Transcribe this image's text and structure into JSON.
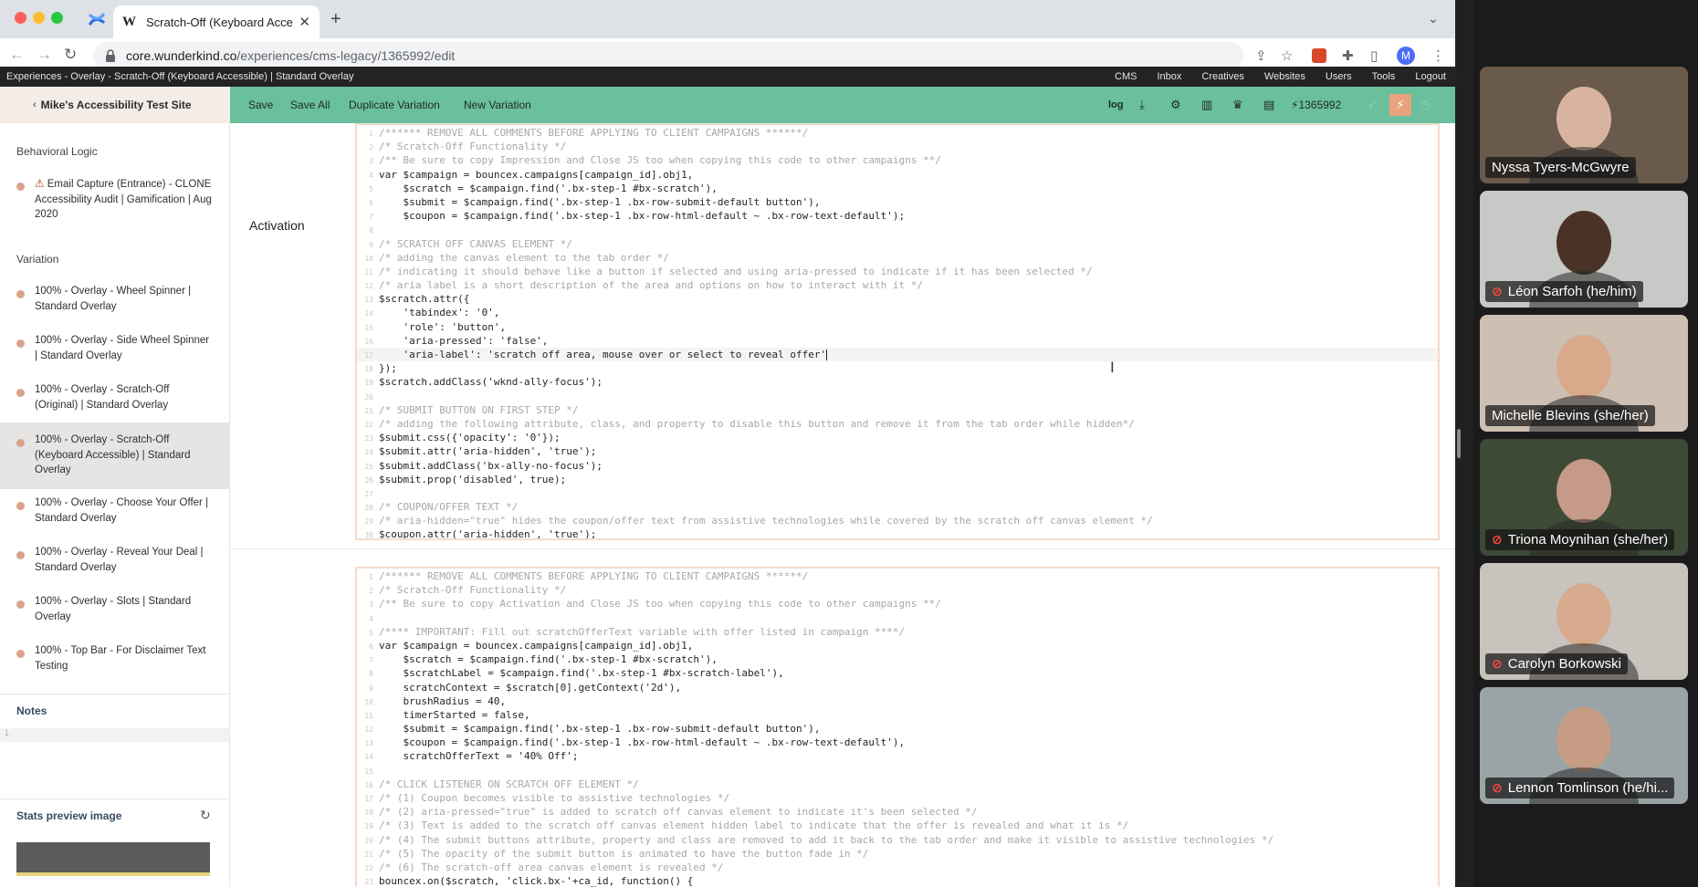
{
  "browser": {
    "tab_title": "Scratch-Off (Keyboard Access",
    "url_host": "core.wunderkind.co",
    "url_path": "/experiences/cms-legacy/1365992/edit",
    "profile_initial": "M"
  },
  "app": {
    "breadcrumb": "Experiences - Overlay - Scratch-Off (Keyboard Accessible) | Standard Overlay",
    "nav": [
      "CMS",
      "Inbox",
      "Creatives",
      "Websites",
      "Users",
      "Tools",
      "Logout"
    ],
    "site_name": "Mike's Accessibility Test Site",
    "actions": {
      "save": "Save",
      "save_all": "Save All",
      "duplicate": "Duplicate Variation",
      "new_variation": "New Variation",
      "log": "log",
      "campaign_id": "1365992"
    }
  },
  "sidebar": {
    "behavioral_heading": "Behavioral Logic",
    "behavioral_item": "Email Capture (Entrance) - CLONE Accessibility Audit | Gamification | Aug 2020",
    "variation_heading": "Variation",
    "variations": [
      "100% - Overlay - Wheel Spinner | Standard Overlay",
      "100% - Overlay - Side Wheel Spinner | Standard Overlay",
      "100% - Overlay - Scratch-Off (Original) | Standard Overlay",
      "100% - Overlay - Scratch-Off (Keyboard Accessible) | Standard Overlay",
      "100% - Overlay - Choose Your Offer | Standard Overlay",
      "100% - Overlay - Reveal Your Deal | Standard Overlay",
      "100% - Overlay - Slots | Standard Overlay",
      "100% - Top Bar - For Disclaimer Text Testing"
    ],
    "active_variation_index": 3,
    "notes_label": "Notes",
    "notes_value": "1",
    "stats_label": "Stats preview image"
  },
  "main": {
    "activation_label": "Activation",
    "editor1": [
      {
        "n": "1",
        "t": "/****** REMOVE ALL COMMENTS BEFORE APPLYING TO CLIENT CAMPAIGNS ******/",
        "c": true
      },
      {
        "n": "2",
        "t": "/* Scratch-Off Functionality */",
        "c": true
      },
      {
        "n": "3",
        "t": "/** Be sure to copy Impression and Close JS too when copying this code to other campaigns **/",
        "c": true
      },
      {
        "n": "4",
        "t": "var $campaign = bouncex.campaigns[campaign_id].obj1,"
      },
      {
        "n": "5",
        "t": "    $scratch = $campaign.find('.bx-step-1 #bx-scratch'),"
      },
      {
        "n": "6",
        "t": "    $submit = $campaign.find('.bx-step-1 .bx-row-submit-default button'),"
      },
      {
        "n": "7",
        "t": "    $coupon = $campaign.find('.bx-step-1 .bx-row-html-default ~ .bx-row-text-default');"
      },
      {
        "n": "8",
        "t": ""
      },
      {
        "n": "9",
        "t": "/* SCRATCH OFF CANVAS ELEMENT */",
        "c": true
      },
      {
        "n": "10",
        "t": "/* adding the canvas element to the tab order */",
        "c": true
      },
      {
        "n": "11",
        "t": "/* indicating it should behave like a button if selected and using aria-pressed to indicate if it has been selected */",
        "c": true
      },
      {
        "n": "12",
        "t": "/* aria label is a short description of the area and options on how to interact with it */",
        "c": true
      },
      {
        "n": "13",
        "t": "$scratch.attr({"
      },
      {
        "n": "14",
        "t": "    'tabindex': '0',"
      },
      {
        "n": "15",
        "t": "    'role': 'button',"
      },
      {
        "n": "16",
        "t": "    'aria-pressed': 'false',"
      },
      {
        "n": "17",
        "t": "    'aria-label': 'scratch off area, mouse over or select to reveal offer'",
        "cur": true
      },
      {
        "n": "18",
        "t": "});"
      },
      {
        "n": "19",
        "t": "$scratch.addClass('wknd-ally-focus');"
      },
      {
        "n": "20",
        "t": ""
      },
      {
        "n": "21",
        "t": "/* SUBMIT BUTTON ON FIRST STEP */",
        "c": true
      },
      {
        "n": "22",
        "t": "/* adding the following attribute, class, and property to disable this button and remove it from the tab order while hidden*/",
        "c": true
      },
      {
        "n": "23",
        "t": "$submit.css({'opacity': '0'});"
      },
      {
        "n": "24",
        "t": "$submit.attr('aria-hidden', 'true');"
      },
      {
        "n": "25",
        "t": "$submit.addClass('bx-ally-no-focus');"
      },
      {
        "n": "26",
        "t": "$submit.prop('disabled', true);"
      },
      {
        "n": "27",
        "t": ""
      },
      {
        "n": "28",
        "t": "/* COUPON/OFFER TEXT */",
        "c": true
      },
      {
        "n": "29",
        "t": "/* aria-hidden=\"true\" hides the coupon/offer text from assistive technologies while covered by the scratch off canvas element */",
        "c": true
      },
      {
        "n": "30",
        "t": "$coupon.attr('aria-hidden', 'true');"
      }
    ],
    "editor2": [
      {
        "n": "1",
        "t": "/****** REMOVE ALL COMMENTS BEFORE APPLYING TO CLIENT CAMPAIGNS ******/",
        "c": true
      },
      {
        "n": "2",
        "t": "/* Scratch-Off Functionality */",
        "c": true
      },
      {
        "n": "3",
        "t": "/** Be sure to copy Activation and Close JS too when copying this code to other campaigns **/",
        "c": true
      },
      {
        "n": "4",
        "t": ""
      },
      {
        "n": "5",
        "t": "/**** IMPORTANT: Fill out scratchOfferText variable with offer listed in campaign ****/",
        "c": true
      },
      {
        "n": "6",
        "t": "var $campaign = bouncex.campaigns[campaign_id].obj1,"
      },
      {
        "n": "7",
        "t": "    $scratch = $campaign.find('.bx-step-1 #bx-scratch'),"
      },
      {
        "n": "8",
        "t": "    $scratchLabel = $campaign.find('.bx-step-1 #bx-scratch-label'),"
      },
      {
        "n": "9",
        "t": "    scratchContext = $scratch[0].getContext('2d'),"
      },
      {
        "n": "10",
        "t": "    brushRadius = 40,"
      },
      {
        "n": "11",
        "t": "    timerStarted = false,"
      },
      {
        "n": "12",
        "t": "    $submit = $campaign.find('.bx-step-1 .bx-row-submit-default button'),"
      },
      {
        "n": "13",
        "t": "    $coupon = $campaign.find('.bx-step-1 .bx-row-html-default ~ .bx-row-text-default'),"
      },
      {
        "n": "14",
        "t": "    scratchOfferText = '40% Off';"
      },
      {
        "n": "15",
        "t": ""
      },
      {
        "n": "16",
        "t": "/* CLICK LISTENER ON SCRATCH OFF ELEMENT */",
        "c": true
      },
      {
        "n": "17",
        "t": "/* (1) Coupon becomes visible to assistive technologies */",
        "c": true
      },
      {
        "n": "18",
        "t": "/* (2) aria-pressed=\"true\" is added to scratch off canvas element to indicate it's been selected */",
        "c": true
      },
      {
        "n": "19",
        "t": "/* (3) Text is added to the scratch off canvas element hidden label to indicate that the offer is revealed and what it is */",
        "c": true
      },
      {
        "n": "20",
        "t": "/* (4) The submit buttons attribute, property and class are removed to add it back to the tab order and make it visible to assistive technologies */",
        "c": true
      },
      {
        "n": "21",
        "t": "/* (5) The opacity of the submit button is animated to have the button fade in */",
        "c": true
      },
      {
        "n": "22",
        "t": "/* (6) The scratch-off area canvas element is revealed */",
        "c": true
      },
      {
        "n": "23",
        "t": "bouncex.on($scratch, 'click.bx-'+ca_id, function() {"
      }
    ]
  },
  "zoom": {
    "participants": [
      {
        "name": "Nyssa Tyers-McGwyre",
        "muted": false,
        "speaking": false,
        "bg": "#6a5a4c",
        "face": "#d8b4a0"
      },
      {
        "name": "Léon Sarfoh (he/him)",
        "muted": true,
        "speaking": false,
        "bg": "#c8c8c6",
        "face": "#4a3326"
      },
      {
        "name": "Michelle Blevins (she/her)",
        "muted": false,
        "speaking": true,
        "bg": "#cdbfb2",
        "face": "#d9a98c"
      },
      {
        "name": "Triona Moynihan (she/her)",
        "muted": true,
        "speaking": false,
        "bg": "#3e4a36",
        "face": "#c59a86"
      },
      {
        "name": "Carolyn Borkowski",
        "muted": true,
        "speaking": false,
        "bg": "#c9c3bd",
        "face": "#d8ab8f"
      },
      {
        "name": "Lennon Tomlinson (he/hi...",
        "muted": true,
        "speaking": false,
        "bg": "#9aa3a5",
        "face": "#c69c84"
      }
    ]
  }
}
